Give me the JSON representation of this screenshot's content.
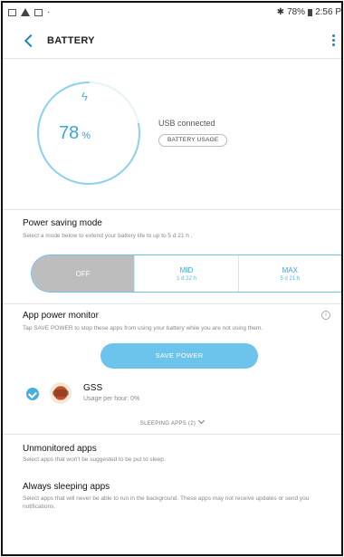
{
  "status_bar": {
    "battery": "78%",
    "time": "2:56 P"
  },
  "app_bar": {
    "title": "BATTERY"
  },
  "battery": {
    "level_percent": 78,
    "percent_value": "78",
    "percent_unit": "%",
    "usb_text": "USB connected",
    "usage_button": "BATTERY USAGE"
  },
  "power_saving": {
    "title": "Power saving mode",
    "subtitle": "Select a mode below to extend your battery life to up to 5 d 21 h .",
    "modes": [
      {
        "label": "OFF",
        "sub": ""
      },
      {
        "label": "MID",
        "sub": "1 d 22 h"
      },
      {
        "label": "MAX",
        "sub": "5 d 21 h"
      }
    ]
  },
  "app_power_monitor": {
    "title": "App power monitor",
    "subtitle": "Tap SAVE POWER to stop these apps from using your battery while you are not using them.",
    "save_button": "SAVE POWER",
    "apps": [
      {
        "name": "GSS",
        "usage": "Usage per hour: 0%"
      }
    ],
    "sleeping_apps": "SLEEPING APPS (2)"
  },
  "unmonitored": {
    "title": "Unmonitored apps",
    "subtitle": "Select apps that won't be suggested to be put to sleep."
  },
  "always_sleeping": {
    "title": "Always sleeping apps",
    "subtitle": "Select apps that will never be able to run in the background. These apps may not receive updates or send you notifications."
  },
  "colors": {
    "accent": "#3aa6d6",
    "ring": "#8fd0ee",
    "mode_off_bg": "#bdbdbd",
    "save_button": "#6cc3eb"
  }
}
